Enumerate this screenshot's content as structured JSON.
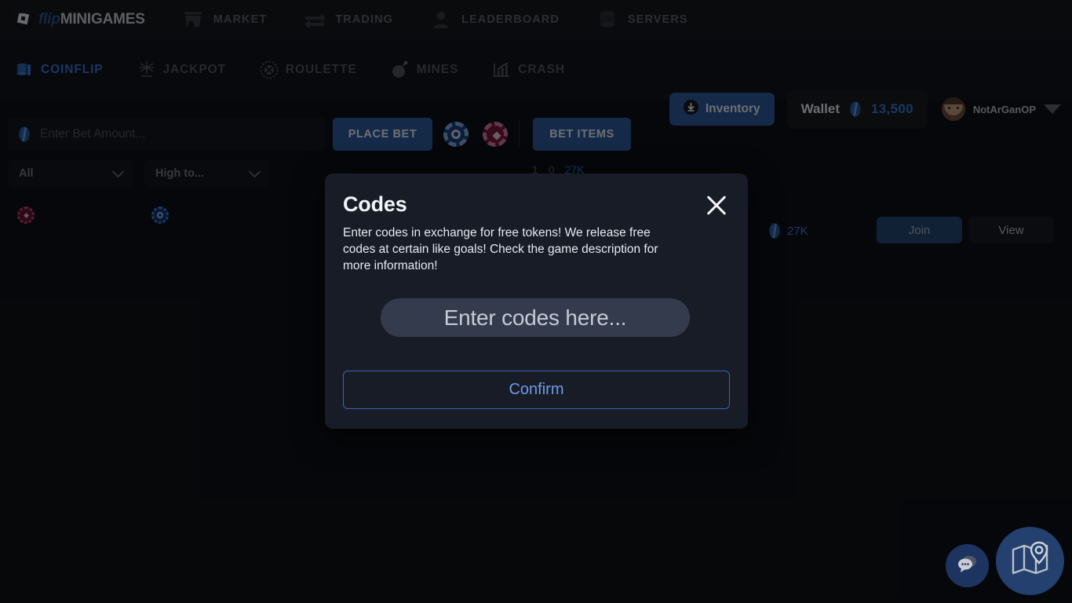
{
  "brand": {
    "flip": "flip",
    "minigames": "MINIGAMES",
    "logo_icon": "roblox-logo-icon"
  },
  "topnav": [
    {
      "label": "MARKET",
      "icon": "store-icon"
    },
    {
      "label": "TRADING",
      "icon": "swap-arrows-icon"
    },
    {
      "label": "LEADERBOARD",
      "icon": "person-icon"
    },
    {
      "label": "SERVERS",
      "icon": "database-icon"
    }
  ],
  "games": [
    {
      "label": "COINFLIP",
      "icon": "coins-stack-icon",
      "active": true
    },
    {
      "label": "JACKPOT",
      "icon": "burst-icon",
      "active": false
    },
    {
      "label": "ROULETTE",
      "icon": "roulette-wheel-icon",
      "active": false
    },
    {
      "label": "MINES",
      "icon": "bomb-icon",
      "active": false
    },
    {
      "label": "CRASH",
      "icon": "chart-up-icon",
      "active": false
    }
  ],
  "account": {
    "inventory_label": "Inventory",
    "inventory_icon": "download-circle-icon",
    "wallet_label": "Wallet",
    "wallet_icon": "token-icon",
    "wallet_amount": "13,500",
    "username": "NotArGanOP",
    "avatar_icon": "user-avatar",
    "dropdown_icon": "caret-down-icon"
  },
  "betbar": {
    "amount_value": "",
    "amount_placeholder": "Enter Bet Amount...",
    "token_icon": "token-icon",
    "place_bet_label": "PLACE BET",
    "chip_blue_icon": "blue-chip-icon",
    "chip_red_icon": "red-chip-icon",
    "bet_items_label": "BET ITEMS"
  },
  "filters": [
    {
      "value": "All",
      "icon": "chevron-down-icon"
    },
    {
      "value": "High to...",
      "icon": "chevron-down-icon"
    }
  ],
  "gamerow": {
    "chip_red_icon": "red-chip-icon",
    "chip_blue_icon": "blue-chip-icon",
    "items_count": "1",
    "players_count": "0",
    "meta_value": "27K",
    "price": "27K",
    "price_icon": "token-icon",
    "join_label": "Join",
    "view_label": "View"
  },
  "modal": {
    "title": "Codes",
    "description": "Enter codes in exchange for free tokens! We release free codes at certain like goals! Check the game description for more information!",
    "close_icon": "close-icon",
    "input_value": "",
    "input_placeholder": "Enter codes here...",
    "confirm_label": "Confirm"
  },
  "fab": {
    "chat_icon": "chat-bubbles-icon",
    "map_icon": "map-pin-icon"
  },
  "colors": {
    "accent_blue": "#3b72d6",
    "button_blue": "#2c5599",
    "modal_bg": "#181c26",
    "page_bg": "#0a0b0e",
    "chip_red": "#6d1230"
  }
}
